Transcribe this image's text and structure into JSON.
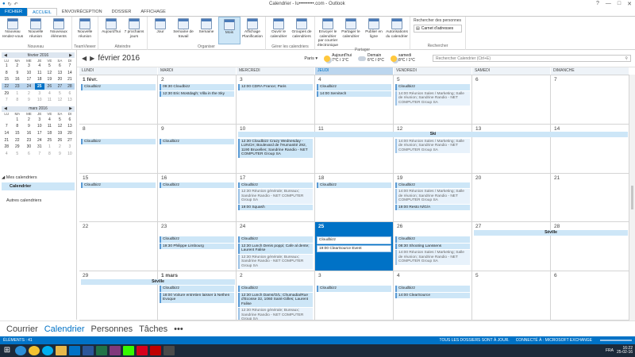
{
  "app": {
    "title": "Calendrier - lu•••••••••.com - Outlook",
    "window_controls": [
      "?",
      "—",
      "□",
      "✕"
    ]
  },
  "tabs": [
    {
      "label": "FICHIER",
      "kind": "file"
    },
    {
      "label": "ACCUEIL",
      "kind": "active"
    },
    {
      "label": "ENVOI/RÉCEPTION",
      "kind": ""
    },
    {
      "label": "DOSSIER",
      "kind": ""
    },
    {
      "label": "AFFICHAGE",
      "kind": ""
    }
  ],
  "ribbon": {
    "groups": [
      {
        "label": "Nouveau",
        "buttons": [
          "Nouveau rendez-vous",
          "Nouvelle réunion",
          "Nouveaux éléments"
        ]
      },
      {
        "label": "TeamViewer",
        "buttons": [
          "Nouvelle réunion"
        ]
      },
      {
        "label": "Atteindre",
        "buttons": [
          "Aujourd'hui",
          "7 prochains jours"
        ]
      },
      {
        "label": "Organiser",
        "buttons": [
          "Jour",
          "Semaine de travail",
          "Semaine",
          "Mois",
          "Affichage Planification"
        ]
      },
      {
        "label": "Gérer les calendriers",
        "buttons": [
          "Ouvrir le calendrier",
          "Groupes de calendriers"
        ]
      },
      {
        "label": "Partager",
        "buttons": [
          "Envoyer le calendrier par courrier électronique",
          "Partager le calendrier",
          "Publier en ligne",
          "Autorisations du calendrier"
        ]
      }
    ],
    "search": {
      "label": "Rechercher des personnes",
      "address_book": "Carnet d'adresses",
      "group_label": "Rechercher"
    }
  },
  "minical": [
    {
      "title": "février 2016",
      "days": [
        "LU",
        "MA",
        "ME",
        "JE",
        "VE",
        "SA",
        "DI"
      ],
      "weeks": [
        [
          "1",
          "2",
          "3",
          "4",
          "5",
          "6",
          "7"
        ],
        [
          "8",
          "9",
          "10",
          "11",
          "12",
          "13",
          "14"
        ],
        [
          "15",
          "16",
          "17",
          "18",
          "19",
          "20",
          "21"
        ],
        [
          "22",
          "23",
          "24",
          "25",
          "26",
          "27",
          "28"
        ],
        [
          "29",
          "1",
          "2",
          "3",
          "4",
          "5",
          "6"
        ],
        [
          "7",
          "8",
          "9",
          "10",
          "11",
          "12",
          "13"
        ]
      ]
    },
    {
      "title": "mars 2016",
      "days": [
        "LU",
        "MA",
        "ME",
        "JE",
        "VE",
        "SA",
        "DI"
      ],
      "weeks": [
        [
          "",
          "1",
          "2",
          "3",
          "4",
          "5",
          "6"
        ],
        [
          "7",
          "8",
          "9",
          "10",
          "11",
          "12",
          "13"
        ],
        [
          "14",
          "15",
          "16",
          "17",
          "18",
          "19",
          "20"
        ],
        [
          "21",
          "22",
          "23",
          "24",
          "25",
          "26",
          "27"
        ],
        [
          "28",
          "29",
          "30",
          "31",
          "1",
          "2",
          "3"
        ],
        [
          "4",
          "5",
          "6",
          "7",
          "8",
          "9",
          "10"
        ]
      ]
    }
  ],
  "folders": {
    "header": "◢ Mes calendriers",
    "selected": "Calendrier",
    "other": "Autres calendriers"
  },
  "calendar": {
    "month_title": "février 2016",
    "city": "Paris ▾",
    "weather": [
      {
        "day": "Aujourd'hui",
        "temp": "7°C / 1°C",
        "icon": "partly-sunny-icon"
      },
      {
        "day": "Demain",
        "temp": "6°C / 0°C",
        "icon": "cloud-icon"
      },
      {
        "day": "samedi",
        "temp": "8°C / 1°C",
        "icon": "partly-sunny-icon"
      }
    ],
    "search_placeholder": "Rechercher Calendrier (Ctrl+E)",
    "day_headers": [
      "LUNDI",
      "MARDI",
      "MERCREDI",
      "JEUDI",
      "VENDREDI",
      "SAMEDI",
      "DIMANCHE"
    ],
    "weeks": [
      [
        {
          "d": "1 févr.",
          "first": true,
          "ev": [
            {
              "t": "Cloudbizz"
            }
          ]
        },
        {
          "d": "2",
          "ev": [
            {
              "t": "09:30 Cloudbizz"
            },
            {
              "t": "12:30 Eric Mostdagh; Villa in the Sky"
            }
          ]
        },
        {
          "d": "3",
          "ev": [
            {
              "t": "12:00 CDRA France; Paris"
            }
          ]
        },
        {
          "d": "4",
          "ev": [
            {
              "t": "Cloudbizz"
            },
            {
              "t": "14:00 Servitech"
            }
          ]
        },
        {
          "d": "5",
          "ev": [
            {
              "t": "Cloudbizz"
            },
            {
              "t": "14:00 Réunion Sales / Marketing; Salle de réunion; Sandrine Randio - NET COMPUTER Group SA",
              "tent": true
            }
          ]
        },
        {
          "d": "6",
          "ev": []
        },
        {
          "d": "7",
          "ev": []
        }
      ],
      [
        {
          "d": "8",
          "ev": [
            {
              "t": "Cloudbizz"
            }
          ]
        },
        {
          "d": "9",
          "ev": [
            {
              "t": "Cloudbizz"
            }
          ]
        },
        {
          "d": "10",
          "ev": [
            {
              "t": "12:30 Cloudbizz Crazy Wednesday - LUNCH; Boulevard de l'Humanité 292, 1190 Bruxelles; Sandrine Randio - NET COMPUTER Group SA"
            }
          ]
        },
        {
          "d": "11",
          "ev": []
        },
        {
          "d": "12",
          "ev": [
            {
              "t": "14:00 Réunion Sales / Marketing; Salle de réunion; Sandrine Randio - NET COMPUTER Group SA",
              "tent": true
            }
          ]
        },
        {
          "d": "13",
          "ev": []
        },
        {
          "d": "14",
          "ev": []
        }
      ],
      [
        {
          "d": "15",
          "ev": [
            {
              "t": "Cloudbizz"
            }
          ]
        },
        {
          "d": "16",
          "ev": [
            {
              "t": "Cloudbizz"
            }
          ]
        },
        {
          "d": "17",
          "ev": [
            {
              "t": "Cloudbizz"
            },
            {
              "t": "12:30 Réunion générale; Bureaux; Sandrine Randio - NET COMPUTER Group SA",
              "tent": true
            },
            {
              "t": "19:00 Squash"
            }
          ]
        },
        {
          "d": "18",
          "ev": [
            {
              "t": "Cloudbizz"
            }
          ]
        },
        {
          "d": "19",
          "ev": [
            {
              "t": "Cloudbizz"
            },
            {
              "t": "14:00 Réunion Sales / Marketing; Salle de réunion; Sandrine Randio - NET COMPUTER Group SA",
              "tent": true
            },
            {
              "t": "19:00 Resto N/G/A"
            }
          ]
        },
        {
          "d": "20",
          "ev": []
        },
        {
          "d": "21",
          "ev": []
        }
      ],
      [
        {
          "d": "22",
          "ev": []
        },
        {
          "d": "23",
          "ev": [
            {
              "t": "Cloudbizz"
            },
            {
              "t": "19:30 Philippe Limbourg"
            }
          ]
        },
        {
          "d": "24",
          "ev": [
            {
              "t": "Cloudbizz"
            },
            {
              "t": "12:30 Lunch Denis poppi; Cafe al dente; Laurent Falise"
            },
            {
              "t": "12:30 Réunion générale; Bureaux; Sandrine Randio - NET COMPUTER Group SA",
              "tent": true
            }
          ]
        },
        {
          "d": "25",
          "today": true,
          "ev": [
            {
              "t": "Cloudbizz",
              "white": true
            },
            {
              "t": "19:00 ClearSource Event",
              "white": true
            }
          ]
        },
        {
          "d": "26",
          "ev": [
            {
              "t": "Cloudbizz"
            },
            {
              "t": "08:30 Shooting Lanssens"
            },
            {
              "t": "14:00 Réunion Sales / Marketing; Salle de réunion; Sandrine Randio - NET COMPUTER Group SA",
              "tent": true
            }
          ]
        },
        {
          "d": "27",
          "ev": []
        },
        {
          "d": "28",
          "ev": []
        }
      ],
      [
        {
          "d": "29",
          "ev": []
        },
        {
          "d": "1 mars",
          "first": true,
          "ev": [
            {
              "t": "Cloudbizz"
            },
            {
              "t": "18:00 Voiture entretien laisser à Nethen Evoque"
            }
          ]
        },
        {
          "d": "2",
          "ev": [
            {
              "t": "Cloudbizz"
            },
            {
              "t": "12:30 Lunch Dams/O/L; Chumadia/Rue d'Ecosse 32, 1060 Saint-Gilles; Laurent Falise"
            },
            {
              "t": "12:30 Réunion générale; Bureaux; Sandrine Randio - NET COMPUTER Group SA",
              "tent": true
            }
          ]
        },
        {
          "d": "3",
          "ev": [
            {
              "t": "Cloudbizz"
            }
          ]
        },
        {
          "d": "4",
          "ev": [
            {
              "t": "Cloudbizz"
            },
            {
              "t": "14:00 ClearSource"
            }
          ]
        },
        {
          "d": "5",
          "ev": []
        },
        {
          "d": "6",
          "ev": []
        }
      ]
    ],
    "spans": {
      "ski": "Ski",
      "seville1": "Séville",
      "seville2": "Séville"
    }
  },
  "navbar": [
    "Courrier",
    "Calendrier",
    "Personnes",
    "Tâches",
    "•••"
  ],
  "status": {
    "items": "ÉLÉMENTS : 41",
    "sync": "TOUS LES DOSSIERS SONT À JOUR.",
    "conn": "CONNECTÉ À : MICROSOFT EXCHANGE"
  },
  "taskbar": {
    "lang": "FRA",
    "time": "16:22",
    "date": "25-02-16"
  }
}
